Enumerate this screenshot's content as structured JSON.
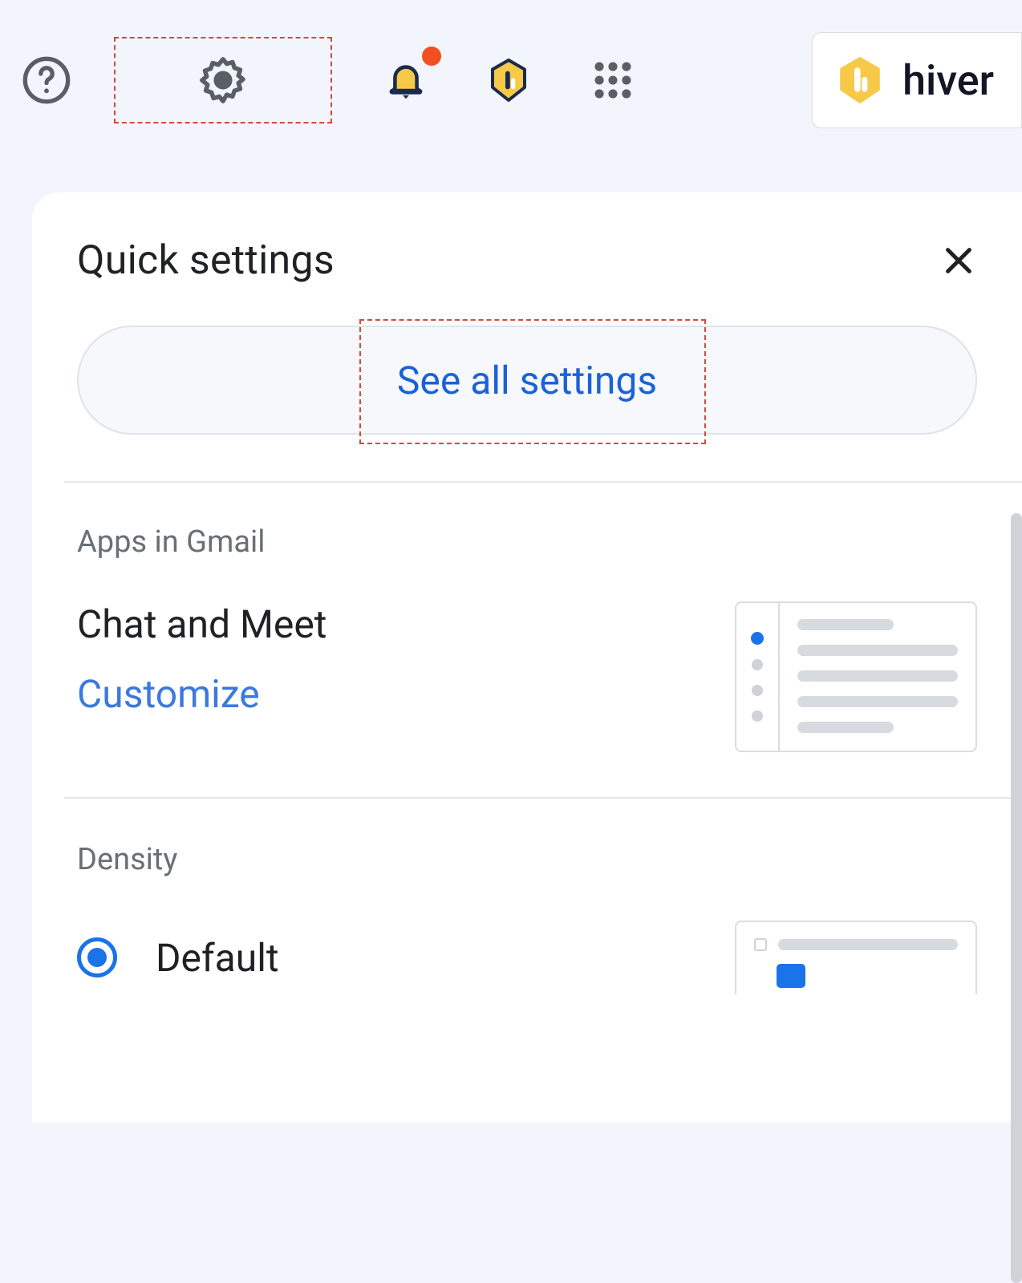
{
  "topbar": {
    "hiver_label": "hiver"
  },
  "panel": {
    "title": "Quick settings",
    "see_all_label": "See all settings"
  },
  "apps_section": {
    "label": "Apps in Gmail",
    "row_name": "Chat and Meet",
    "customize_label": "Customize"
  },
  "density_section": {
    "label": "Density",
    "options": [
      {
        "name": "Default",
        "selected": true
      }
    ]
  }
}
